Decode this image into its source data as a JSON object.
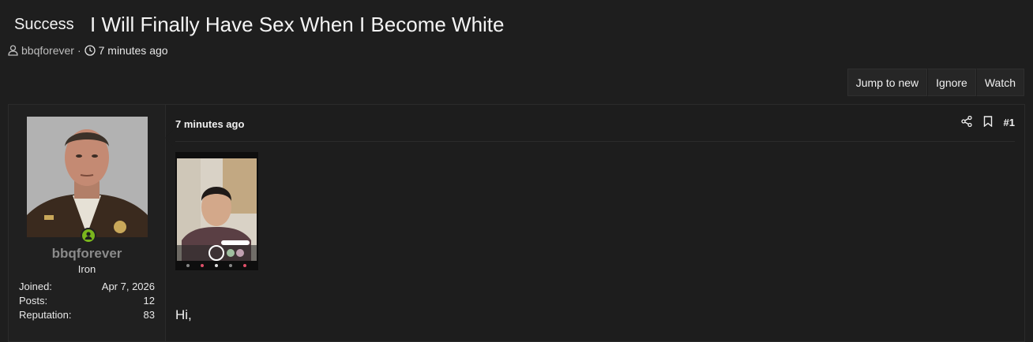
{
  "thread": {
    "prefix": "Success",
    "title": "I Will Finally Have Sex When I Become White",
    "author": "bbqforever",
    "separator": "·",
    "time": "7 minutes ago"
  },
  "actions": {
    "jump": "Jump to new",
    "ignore": "Ignore",
    "watch": "Watch"
  },
  "post": {
    "user": {
      "name": "bbqforever",
      "rank": "Iron",
      "stats": [
        {
          "label": "Joined:",
          "value": "Apr 7, 2026"
        },
        {
          "label": "Posts:",
          "value": "12"
        },
        {
          "label": "Reputation:",
          "value": "83"
        }
      ]
    },
    "date": "7 minutes ago",
    "number": "#1",
    "body": "Hi,"
  },
  "icons": [
    "user-icon",
    "clock-icon",
    "share-icon",
    "bookmark-icon",
    "online-status-icon"
  ],
  "colors": {
    "background": "#1e1e1e",
    "online": "#7ab51d",
    "username": "#8a8a8a"
  }
}
